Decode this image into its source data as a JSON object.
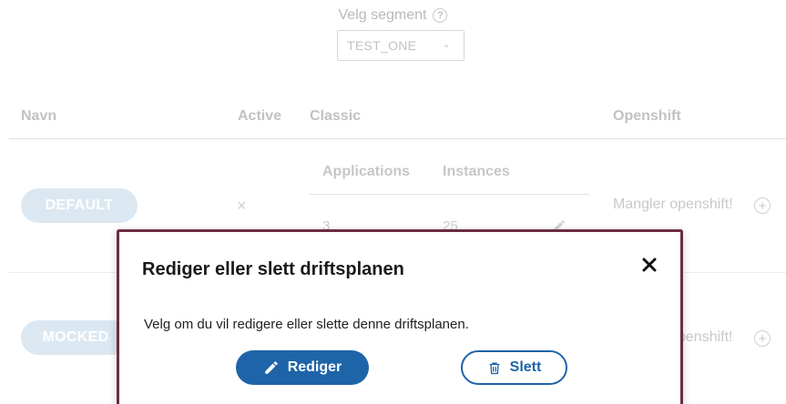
{
  "segment": {
    "label": "Velg segment",
    "selected": "TEST_ONE"
  },
  "table": {
    "headers": {
      "name": "Navn",
      "active": "Active",
      "classic": "Classic",
      "openshift": "Openshift"
    },
    "classic_subheaders": {
      "applications": "Applications",
      "instances": "Instances"
    },
    "rows": [
      {
        "name": "DEFAULT",
        "active": "×",
        "applications": "3",
        "instances": "25",
        "openshift": "Mangler openshift!"
      },
      {
        "name": "MOCKED",
        "openshift_partial": "penshift!"
      }
    ]
  },
  "modal": {
    "title": "Rediger eller slett driftsplanen",
    "body": "Velg om du vil redigere eller slette denne driftsplanen.",
    "edit_label": "Rediger",
    "delete_label": "Slett"
  },
  "colors": {
    "primary": "#1e64a8",
    "modal_border": "#6b2d3e",
    "badge_bg": "#dce8f1"
  },
  "icons": {
    "help": "help-circle-icon",
    "chevron": "chevron-down-icon",
    "close": "close-icon",
    "edit": "pencil-icon",
    "delete": "trash-icon",
    "add": "plus-circle-icon"
  }
}
